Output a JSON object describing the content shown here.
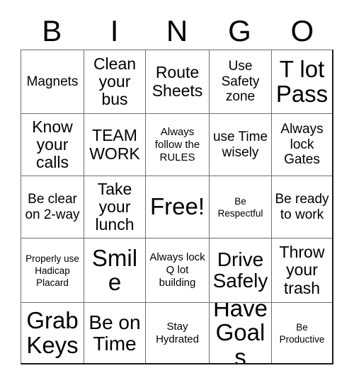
{
  "card": {
    "title": "BINGO",
    "header_letters": [
      "B",
      "I",
      "N",
      "G",
      "O"
    ],
    "free_space": "Free!",
    "colors": {
      "background": "#ffffff",
      "text": "#000000",
      "grid_line": "#6e6e6e",
      "grid_border": "#1a1a1a"
    },
    "rows": [
      [
        {
          "text": "Magnets",
          "size": "md"
        },
        {
          "text": "Clean your bus",
          "size": "lg"
        },
        {
          "text": "Route Sheets",
          "size": "lg"
        },
        {
          "text": "Use Safety zone",
          "size": "md"
        },
        {
          "text": "T lot Pass",
          "size": "xxl"
        }
      ],
      [
        {
          "text": "Know your calls",
          "size": "lg"
        },
        {
          "text": "TEAM WORK",
          "size": "lg"
        },
        {
          "text": "Always follow the RULES",
          "size": "sm"
        },
        {
          "text": "use Time wisely",
          "size": "md"
        },
        {
          "text": "Always lock Gates",
          "size": "md"
        }
      ],
      [
        {
          "text": "Be clear on 2-way",
          "size": "md"
        },
        {
          "text": "Take your lunch",
          "size": "lg"
        },
        {
          "text": "Free!",
          "size": "xxl"
        },
        {
          "text": "Be Respectful",
          "size": "xs"
        },
        {
          "text": "Be ready to work",
          "size": "md"
        }
      ],
      [
        {
          "text": "Properly use Hadicap Placard",
          "size": "xs"
        },
        {
          "text": "Smile",
          "size": "xxl"
        },
        {
          "text": "Always lock Q lot building",
          "size": "sm"
        },
        {
          "text": "Drive Safely",
          "size": "xl"
        },
        {
          "text": "Throw your trash",
          "size": "lg"
        }
      ],
      [
        {
          "text": "Grab Keys",
          "size": "xxl"
        },
        {
          "text": "Be on Time",
          "size": "xl"
        },
        {
          "text": "Stay Hydrated",
          "size": "sm"
        },
        {
          "text": "Have Goals",
          "size": "xxl"
        },
        {
          "text": "Be Productive",
          "size": "xs"
        }
      ]
    ]
  }
}
